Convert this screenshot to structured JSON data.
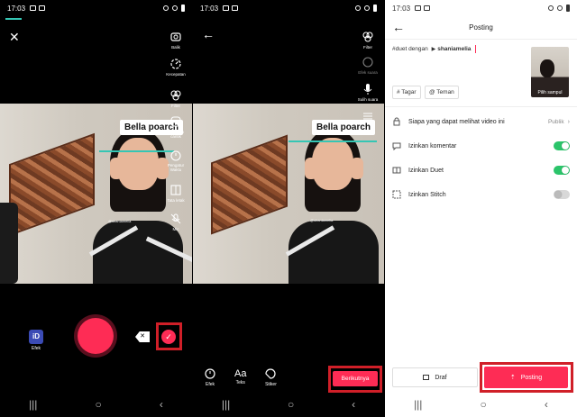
{
  "status": {
    "time": "17:03"
  },
  "camera": {
    "tools": [
      {
        "icon": "flip-camera-icon",
        "label": "Balik"
      },
      {
        "icon": "speed-icon",
        "label": "Kecepatan"
      },
      {
        "icon": "filter-icon",
        "label": "Filter"
      },
      {
        "icon": "beauty-icon",
        "label": "Tampilan cantik"
      },
      {
        "icon": "timer-icon",
        "label": "Pengatur Waktu"
      },
      {
        "icon": "layout-icon",
        "label": "Tata letak"
      },
      {
        "icon": "mic-icon",
        "label": "Mic"
      }
    ],
    "effects_label": "Efek",
    "sticker_text": "Bella poarch",
    "watermark": "@shaniamelia"
  },
  "edit": {
    "tools": [
      {
        "icon": "filter-icon",
        "label": "Filter"
      },
      {
        "icon": "voice-effect-icon",
        "label": "Efek suara"
      },
      {
        "icon": "voiceover-icon",
        "label": "Sulih suara"
      },
      {
        "icon": "adjust-icon",
        "label": ""
      }
    ],
    "bottom_tools": [
      {
        "icon": "effects-icon",
        "label": "Efek"
      },
      {
        "icon": "text-icon",
        "glyph": "Aa",
        "label": "Teks"
      },
      {
        "icon": "sticker-icon",
        "label": "Stiker"
      }
    ],
    "next_label": "Berikutnya",
    "sticker_text": "Bella poarch"
  },
  "posting": {
    "title": "Posting",
    "caption_prefix": "#duet dengan",
    "caption_user": "shaniamelia",
    "cover_label": "Pilih sampul",
    "chip_hashtag": "# Tagar",
    "chip_friends": "@ Teman",
    "privacy_label": "Siapa yang dapat melihat video ini",
    "privacy_value": "Publik",
    "comments_label": "Izinkan komentar",
    "duet_label": "Izinkan Duet",
    "stitch_label": "Izinkan Stitch",
    "comments_on": true,
    "duet_on": true,
    "stitch_on": false,
    "draft_label": "Draf",
    "post_label": "Posting"
  },
  "colors": {
    "accent": "#fe2c55",
    "highlight": "#d01f28",
    "toggle_on": "#2bc46a",
    "guide": "#35c6b4"
  }
}
